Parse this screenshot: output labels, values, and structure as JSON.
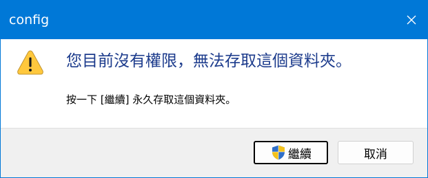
{
  "window": {
    "title": "config"
  },
  "message": {
    "headline": "您目前沒有權限，無法存取這個資料夾。",
    "detail": "按一下 [繼續] 永久存取這個資料夾。"
  },
  "buttons": {
    "continue_label": "繼續",
    "cancel_label": "取消"
  },
  "icons": {
    "warning": "warning-icon",
    "shield": "uac-shield-icon",
    "close": "close-icon"
  },
  "colors": {
    "titlebar": "#0078d7",
    "headline_text": "#1c3b8c",
    "footer_bg": "#f0f0f0",
    "warning_fill": "#ffc83d"
  }
}
